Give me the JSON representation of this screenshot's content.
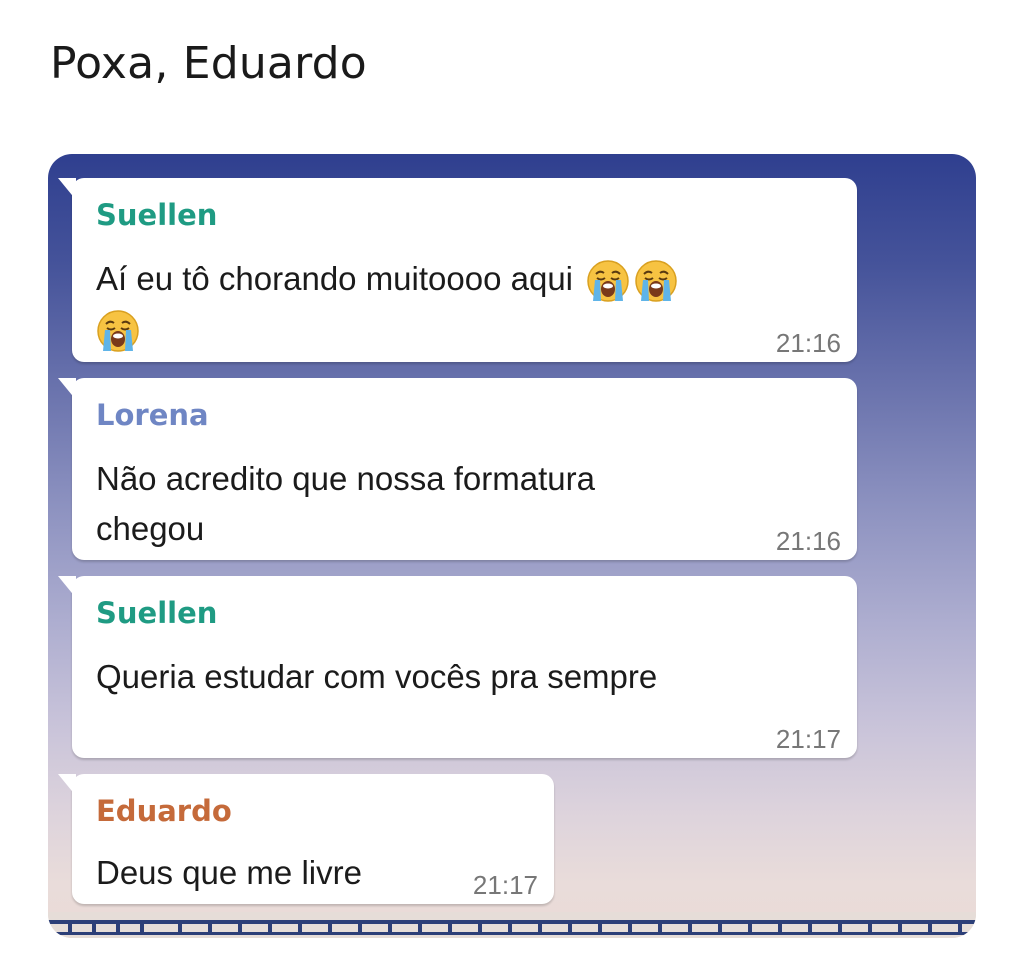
{
  "post": {
    "title": "Poxa, Eduardo"
  },
  "colors": {
    "suellen_name": "#1f9b83",
    "lorena_name": "#6f86c4",
    "eduardo_name": "#c56a3a",
    "bubble": "#ffffff",
    "time": "#777777"
  },
  "messages": [
    {
      "sender": "Suellen",
      "text_line1": "Aí eu tô chorando muitoooo aqui",
      "emoji": "loudly-crying-face",
      "time": "21:16"
    },
    {
      "sender": "Lorena",
      "text_line1": "Não acredito que nossa formatura",
      "text_line2": "chegou",
      "time": "21:16"
    },
    {
      "sender": "Suellen",
      "text_line1": "Queria estudar com vocês pra sempre",
      "time": "21:17"
    },
    {
      "sender": "Eduardo",
      "text_line1": "Deus que me livre",
      "time": "21:17"
    }
  ]
}
